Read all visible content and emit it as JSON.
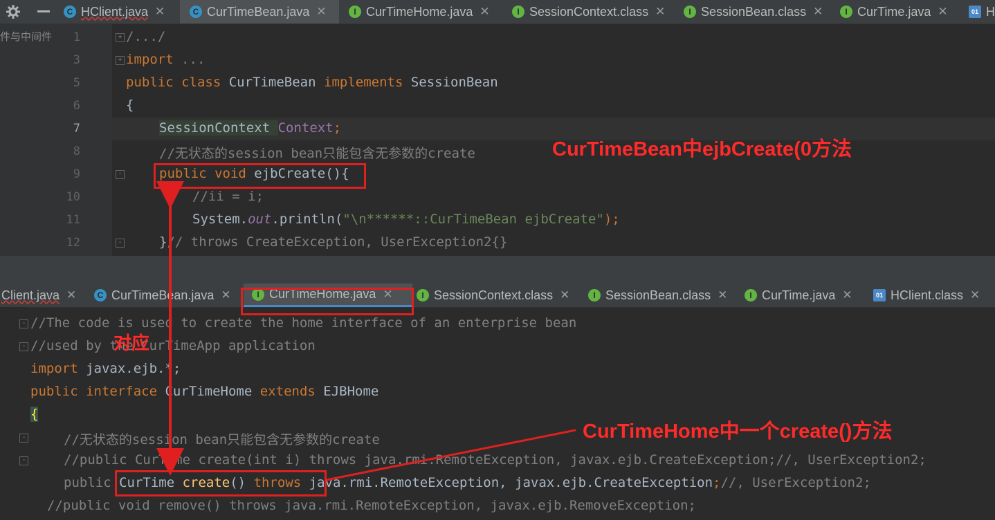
{
  "top_editor": {
    "tabs": [
      {
        "label": "HClient.java",
        "icon": "class-run-icon"
      },
      {
        "label": "CurTimeBean.java",
        "icon": "class-icon"
      },
      {
        "label": "CurTimeHome.java",
        "icon": "interface-icon"
      },
      {
        "label": "SessionContext.class",
        "icon": "interface-icon"
      },
      {
        "label": "SessionBean.class",
        "icon": "interface-icon"
      },
      {
        "label": "CurTime.java",
        "icon": "interface-icon"
      },
      {
        "label": "H",
        "icon": "binary-class-icon"
      }
    ],
    "active_tab": "CurTimeBean.java",
    "side_label": "件与中间件",
    "line_numbers": [
      "1",
      "3",
      "5",
      "6",
      "7",
      "8",
      "9",
      "10",
      "11",
      "12"
    ],
    "lines": {
      "l1": "/.../",
      "l3_kw": "import",
      "l3_rest": " ...",
      "l5_a": "public class",
      "l5_b": " CurTimeBean ",
      "l5_c": "implements",
      "l5_d": " SessionBean",
      "l6": "{",
      "l7_a": "SessionContext ",
      "l7_b": "Context",
      "l7_c": ";",
      "l8": "//无状态的session bean只能包含无参数的create",
      "l9_a": "public void",
      "l9_b": " ejbCreate(){",
      "l10": "//ii = i;",
      "l11_a": "System.",
      "l11_b": "out",
      "l11_c": ".println(",
      "l11_d": "\"\\n******::CurTimeBean ejbCreate\"",
      "l11_e": ");",
      "l12_a": "}",
      "l12_b": "// throws CreateException, UserException2{}"
    }
  },
  "bottom_editor": {
    "tabs": [
      {
        "label": "Client.java"
      },
      {
        "label": "CurTimeBean.java",
        "icon": "class-icon"
      },
      {
        "label": "CurTimeHome.java",
        "icon": "interface-icon"
      },
      {
        "label": "SessionContext.class",
        "icon": "interface-icon"
      },
      {
        "label": "SessionBean.class",
        "icon": "interface-icon"
      },
      {
        "label": "CurTime.java",
        "icon": "interface-icon"
      },
      {
        "label": "HClient.class",
        "icon": "binary-class-icon"
      }
    ],
    "active_tab": "CurTimeHome.java",
    "lines": {
      "b1": "//The code is used to create the home interface of an enterprise bean",
      "b2": "//used by the CurTimeApp application",
      "b3_a": "import",
      "b3_b": " javax.ejb.*;",
      "b4_a": "public interface",
      "b4_b": " CurTimeHome ",
      "b4_c": "extends",
      "b4_d": " EJBHome",
      "b5": "{",
      "b6": "//无状态的session bean只能包含无参数的create",
      "b7": "//public CurTime create(int i) throws java.rmi.RemoteException, javax.ejb.CreateException;//, UserException2;",
      "b8_a": "public ",
      "b8_b": "CurTime ",
      "b8_c": "create",
      "b8_d": "() ",
      "b8_e": "throws",
      "b8_f": " java.rmi.RemoteException, javax.ejb.CreateException",
      "b8_g": ";",
      "b8_h": "//, UserException2;",
      "b9": "//public void remove() throws java.rmi.RemoteException, javax.ejb.RemoveException;"
    }
  },
  "annotations": {
    "top_note": "CurTimeBean中ejbCreate(0方法",
    "middle_note": "对应",
    "bottom_note": "CurTimeHome中一个create()方法",
    "color": "#e02020"
  }
}
